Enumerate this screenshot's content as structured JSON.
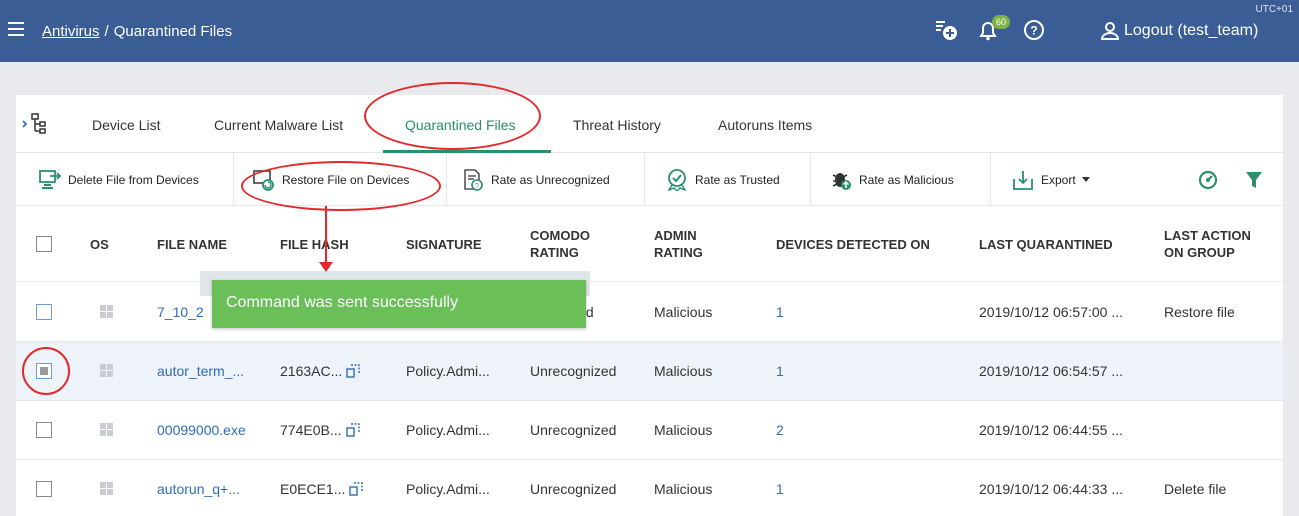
{
  "header": {
    "breadcrumb_root": "Antivirus",
    "breadcrumb_sep": "/",
    "breadcrumb_current": "Quarantined Files",
    "timezone": "UTC+01",
    "notification_count": "60",
    "logout_label": "Logout (test_team)",
    "icons": [
      "menu-icon",
      "add-device-icon",
      "bell-icon",
      "help-icon",
      "user-icon"
    ]
  },
  "tabs": [
    {
      "label": "Device List",
      "active": false
    },
    {
      "label": "Current Malware List",
      "active": false
    },
    {
      "label": "Quarantined Files",
      "active": true
    },
    {
      "label": "Threat History",
      "active": false
    },
    {
      "label": "Autoruns Items",
      "active": false
    }
  ],
  "toolbar": {
    "delete_label": "Delete File from Devices",
    "restore_label": "Restore File on Devices",
    "unrecognized_label": "Rate as Unrecognized",
    "trusted_label": "Rate as Trusted",
    "malicious_label": "Rate as Malicious",
    "export_label": "Export"
  },
  "table": {
    "columns": [
      "OS",
      "FILE NAME",
      "FILE HASH",
      "SIGNATURE",
      "COMODO RATING",
      "ADMIN RATING",
      "DEVICES DETECTED ON",
      "LAST QUARANTINED",
      "LAST ACTION ON GROUP"
    ],
    "col_comodo_1": "COMODO",
    "col_comodo_2": "RATING",
    "col_admin_1": "ADMIN",
    "col_admin_2": "RATING",
    "col_last_action_1": "LAST ACTION",
    "col_last_action_2": "ON GROUP",
    "rows": [
      {
        "file_name": "7_10_2",
        "file_hash": "",
        "signature": "",
        "comodo_rating": "ized",
        "admin_rating": "Malicious",
        "devices": "1",
        "last_quarantined": "2019/10/12 06:57:00 ...",
        "last_action": "Restore file",
        "checked": false
      },
      {
        "file_name": "autor_term_...",
        "file_hash": "2163AC...",
        "signature": "Policy.Admi...",
        "comodo_rating": "Unrecognized",
        "admin_rating": "Malicious",
        "devices": "1",
        "last_quarantined": "2019/10/12 06:54:57 ...",
        "last_action": "",
        "checked": true
      },
      {
        "file_name": "00099000.exe",
        "file_hash": "774E0B...",
        "signature": "Policy.Admi...",
        "comodo_rating": "Unrecognized",
        "admin_rating": "Malicious",
        "devices": "2",
        "last_quarantined": "2019/10/12 06:44:55 ...",
        "last_action": "",
        "checked": false
      },
      {
        "file_name": "autorun_q+...",
        "file_hash": "E0ECE1...",
        "signature": "Policy.Admi...",
        "comodo_rating": "Unrecognized",
        "admin_rating": "Malicious",
        "devices": "1",
        "last_quarantined": "2019/10/12 06:44:33 ...",
        "last_action": "Delete file",
        "checked": false
      }
    ]
  },
  "toast": {
    "message": "Command was sent successfully"
  },
  "colors": {
    "header_bg": "#3a5d96",
    "accent_green": "#2c8f6c",
    "toast_bg": "#6bbf59",
    "link_blue": "#2f6db5",
    "annotation_red": "#e5282a"
  }
}
